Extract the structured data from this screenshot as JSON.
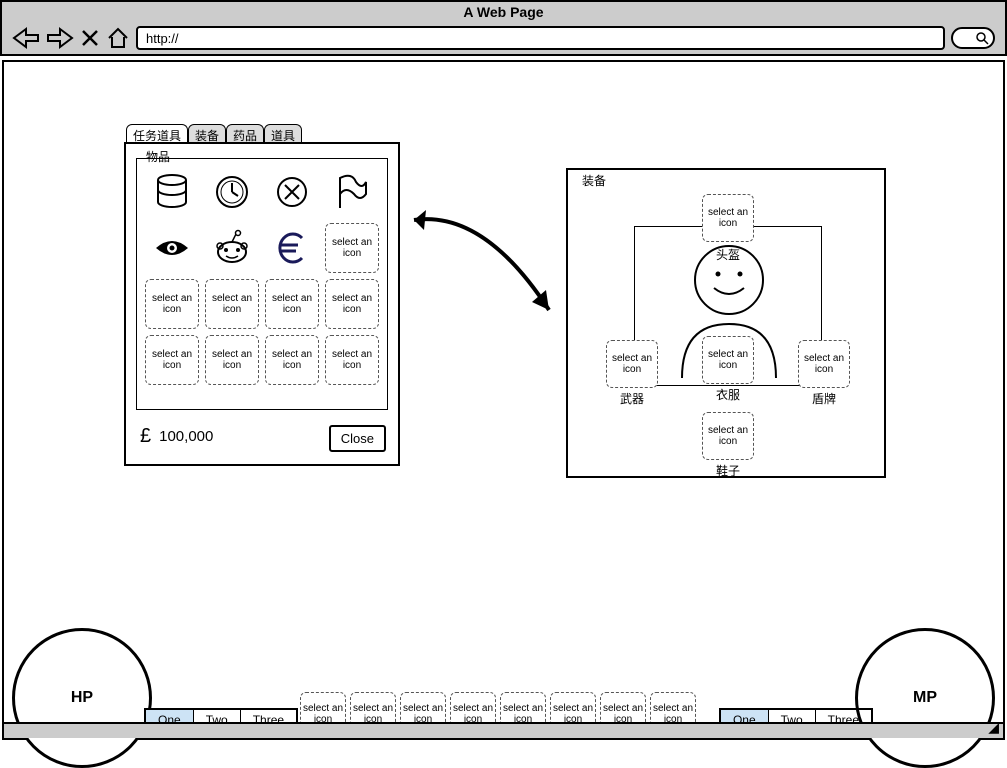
{
  "browser": {
    "title": "A Web Page",
    "url": "http://"
  },
  "inventory": {
    "tabs": [
      "任务道具",
      "装备",
      "药品",
      "道具"
    ],
    "active_tab_index": 0,
    "legend": "物品",
    "placeholder_text": "select an icon",
    "icons": [
      "database-icon",
      "clock-icon",
      "x-circle-icon",
      "flag-icon",
      "eye-icon",
      "reddit-icon",
      "euro-icon"
    ],
    "currency_symbol": "£",
    "currency_amount": "100,000",
    "close_label": "Close"
  },
  "equipment": {
    "legend": "装备",
    "slots": {
      "helmet": {
        "label": "头盔",
        "placeholder": "select an icon"
      },
      "weapon": {
        "label": "武器",
        "placeholder": "select an icon"
      },
      "armor": {
        "label": "衣服",
        "placeholder": "select an icon"
      },
      "shield": {
        "label": "盾牌",
        "placeholder": "select an icon"
      },
      "boots": {
        "label": "鞋子",
        "placeholder": "select an icon"
      }
    }
  },
  "hud": {
    "hp_label": "HP",
    "mp_label": "MP",
    "paginator_left": {
      "items": [
        "One",
        "Two",
        "Three"
      ],
      "selected_index": 0
    },
    "paginator_right": {
      "items": [
        "One",
        "Two",
        "Three"
      ],
      "selected_index": 0
    },
    "skill_placeholder": "select an icon",
    "skill_count": 8
  }
}
